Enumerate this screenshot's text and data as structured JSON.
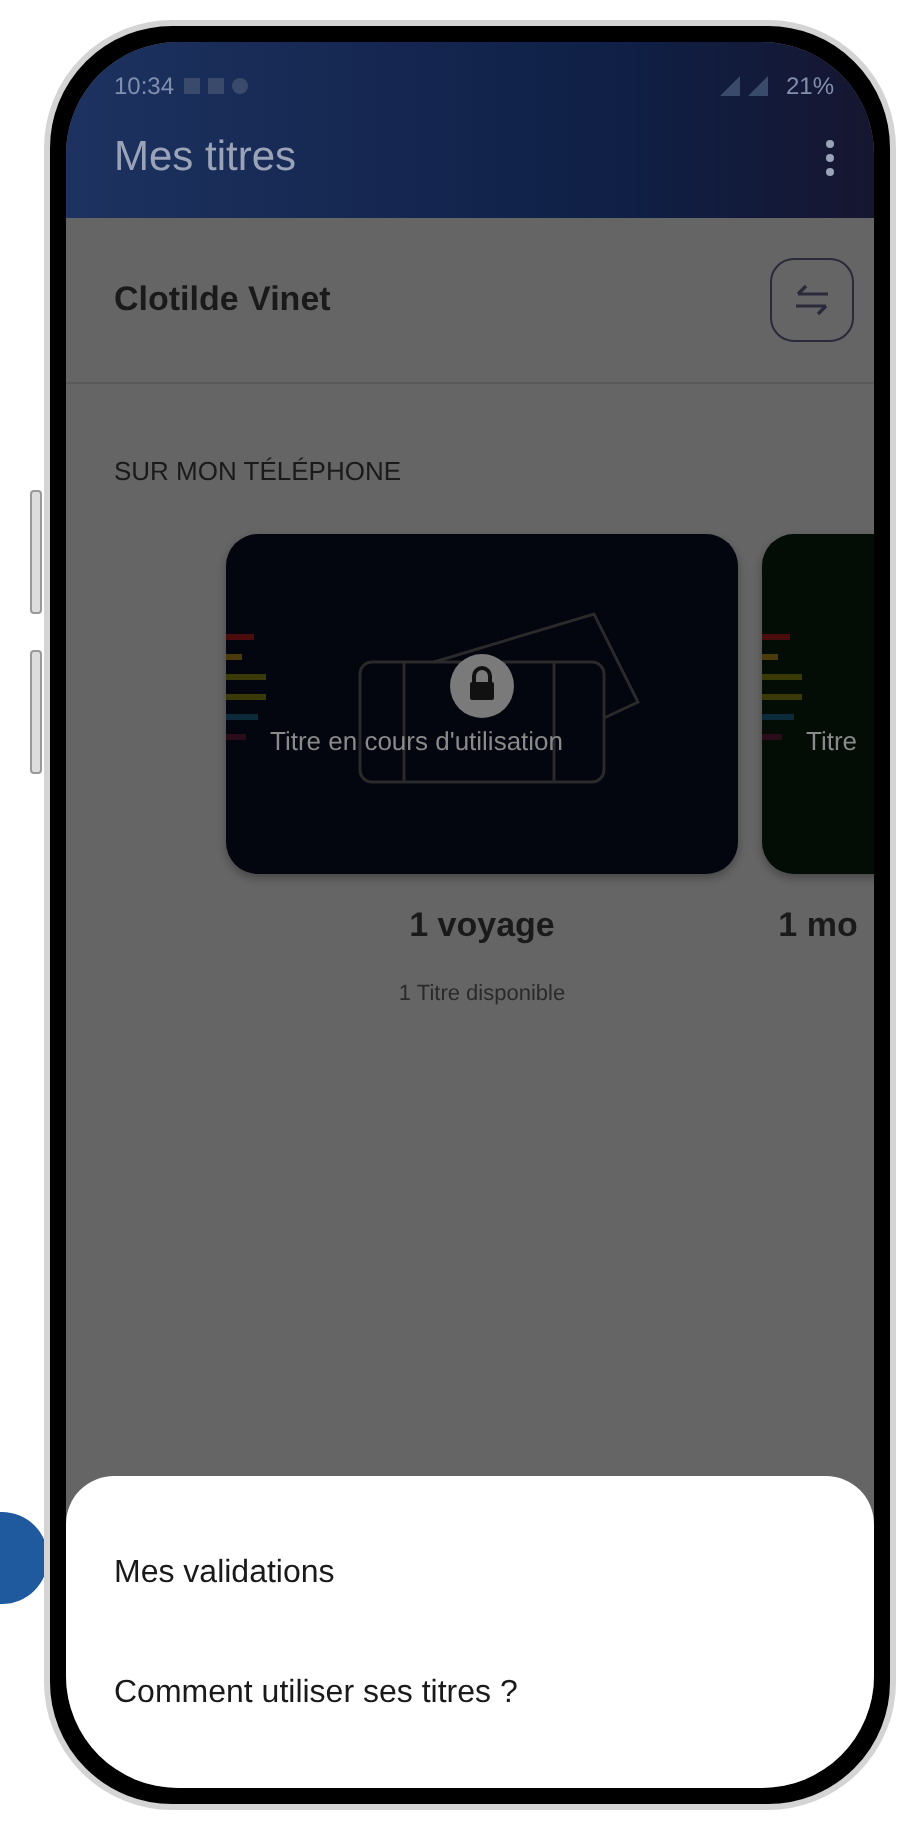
{
  "status_bar": {
    "time": "10:34",
    "battery": "21%"
  },
  "app_bar": {
    "title": "Mes titres"
  },
  "account": {
    "name": "Clotilde Vinet"
  },
  "section": {
    "title": "SUR MON TÉLÉPHONE"
  },
  "cards": [
    {
      "overlay_text": "Titre en cours d'utilisation",
      "locked": true,
      "color": "#03050f",
      "title": "1 voyage",
      "subtitle": "1 Titre disponible"
    },
    {
      "overlay_text": "Titre",
      "locked": false,
      "color": "#030c05",
      "title": "1 mo"
    }
  ],
  "bottom_sheet": {
    "items": [
      "Mes validations",
      "Comment utiliser ses titres ?"
    ]
  }
}
